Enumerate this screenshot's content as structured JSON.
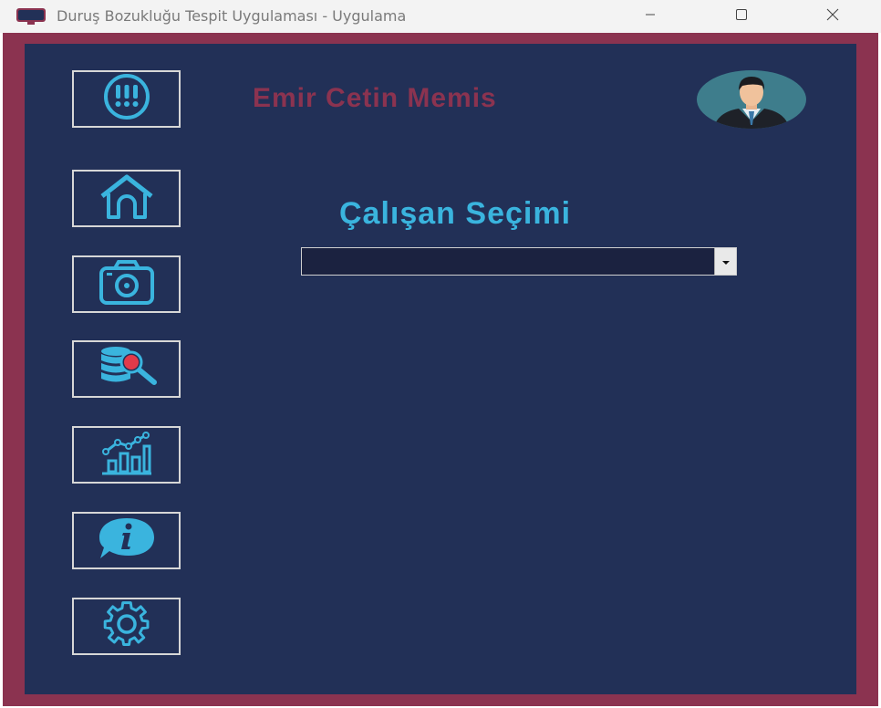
{
  "window": {
    "title": "Duruş Bozukluğu Tespit Uygulaması - Uygulama",
    "icon": "app-monitor-icon",
    "controls": [
      "minimize-icon",
      "maximize-icon",
      "close-icon"
    ]
  },
  "sidebar": {
    "items": [
      {
        "name": "alert",
        "icon": "alert-icon"
      },
      {
        "name": "home",
        "icon": "home-icon"
      },
      {
        "name": "camera",
        "icon": "camera-icon"
      },
      {
        "name": "database-search",
        "icon": "database-search-icon"
      },
      {
        "name": "statistics",
        "icon": "chart-icon"
      },
      {
        "name": "info",
        "icon": "info-icon"
      },
      {
        "name": "settings",
        "icon": "gear-icon"
      }
    ]
  },
  "header": {
    "user_name": "Emir Cetin Memis",
    "avatar_icon": "user-avatar-icon"
  },
  "main": {
    "section_title": "Çalışan Seçimi",
    "employee_select": {
      "value": ""
    }
  },
  "colors": {
    "frame": "#8b3350",
    "panel": "#223057",
    "accent": "#3ab4de",
    "name_text": "#8b3350"
  }
}
